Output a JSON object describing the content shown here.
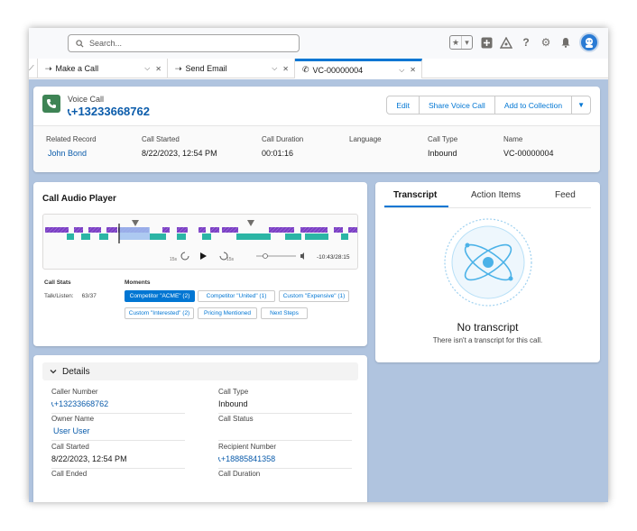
{
  "header": {
    "search_placeholder": "Search...",
    "icons": [
      "star-icon",
      "chevron-down-icon",
      "add-icon",
      "trailhead-icon",
      "help-icon",
      "gear-icon",
      "bell-icon",
      "avatar"
    ]
  },
  "tabs": [
    {
      "label": "Make a Call",
      "icon": "call-arrow-icon"
    },
    {
      "label": "Send Email",
      "icon": "email-arrow-icon"
    },
    {
      "label": "VC-00000004",
      "icon": "phone-icon",
      "active": true
    }
  ],
  "record": {
    "type": "Voice Call",
    "title": "+13233668762",
    "buttons": {
      "edit": "Edit",
      "share": "Share Voice Call",
      "collection": "Add to Collection"
    },
    "fields": [
      {
        "label": "Related Record",
        "value": "John Bond",
        "link": true
      },
      {
        "label": "Call Started",
        "value": "8/22/2023, 12:54 PM"
      },
      {
        "label": "Call Duration",
        "value": "00:01:16"
      },
      {
        "label": "Language",
        "value": ""
      },
      {
        "label": "Call Type",
        "value": "Inbound"
      },
      {
        "label": "Name",
        "value": "VC-00000004"
      }
    ]
  },
  "player": {
    "title": "Call Audio Player",
    "skip_back": "15s",
    "skip_fwd": "15s",
    "time": "-10:43/28:15",
    "stats_header": "Call Stats",
    "talk_listen_label": "Talk/Listen:",
    "talk_listen_value": "63/37",
    "moments_header": "Moments",
    "moments": [
      "Competitor \"ACME\" (2)",
      "Competitor \"United\" (1)",
      "Custom \"Expensive\" (1)",
      "Custom \"Interested\" (2)",
      "Pricing Mentioned",
      "Next Steps"
    ],
    "colors": {
      "purple": "#7b3fc4",
      "teal": "#2bb5a5",
      "blue": "#9fbfee"
    }
  },
  "transcript": {
    "tabs": [
      "Transcript",
      "Action Items",
      "Feed"
    ],
    "empty_title": "No transcript",
    "empty_sub": "There isn't a transcript for this call."
  },
  "details": {
    "header": "Details",
    "fields": [
      {
        "label": "Caller Number",
        "value": "+13233668762",
        "phone": true
      },
      {
        "label": "Call Type",
        "value": "Inbound"
      },
      {
        "label": "Owner Name",
        "value": "User User",
        "link": true
      },
      {
        "label": "Call Status",
        "value": ""
      },
      {
        "label": "Call Started",
        "value": "8/22/2023, 12:54 PM"
      },
      {
        "label": "Recipient Number",
        "value": "+18885841358",
        "phone": true
      },
      {
        "label": "Call Ended",
        "value": ""
      },
      {
        "label": "Call Duration",
        "value": ""
      }
    ]
  }
}
